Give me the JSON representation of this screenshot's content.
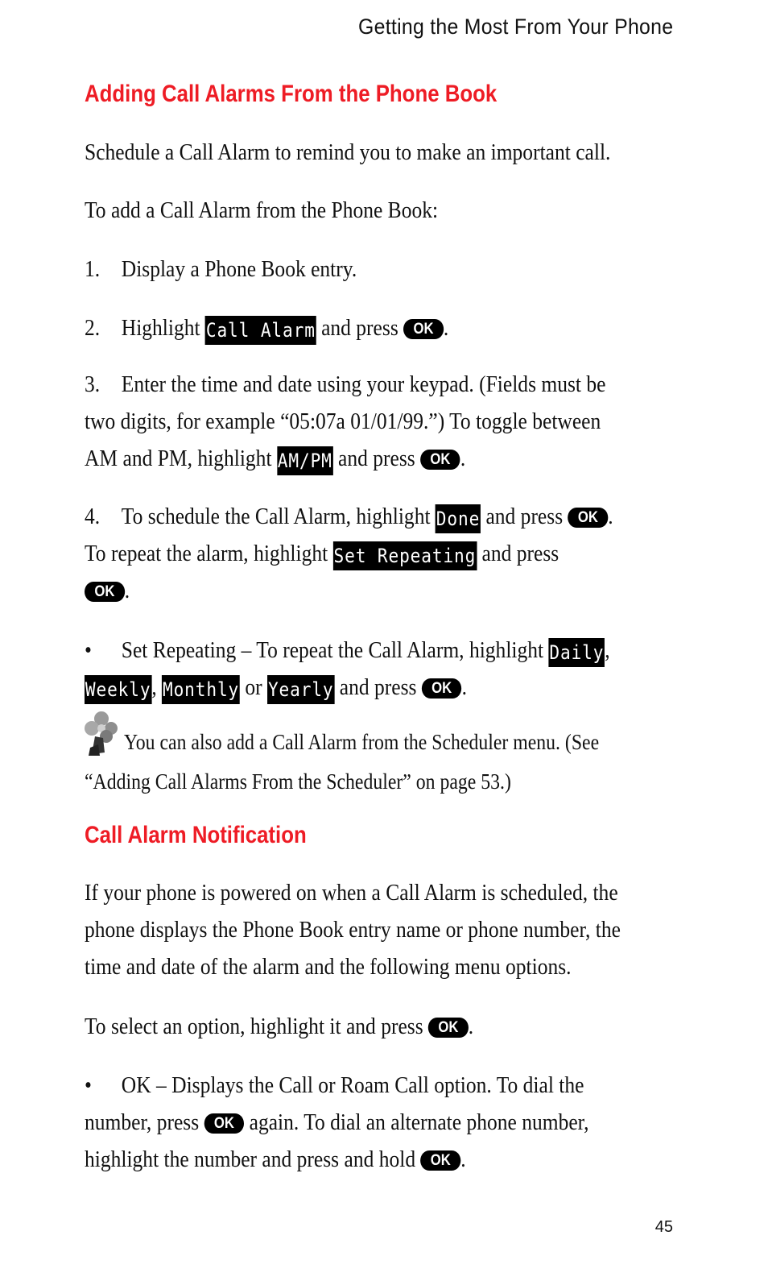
{
  "header": {
    "running_title": "Getting the Most From Your Phone"
  },
  "section1": {
    "heading": "Adding Call Alarms From the Phone Book",
    "intro": "Schedule a Call Alarm to remind you to make an important call.",
    "lead": "To add a Call Alarm from the Phone Book:",
    "steps": [
      {
        "num": "1.",
        "text": "Display a Phone Book entry."
      },
      {
        "num": "2.",
        "pre": "Highlight",
        "lcd": "Call Alarm",
        "post": "and press",
        "key": "OK"
      },
      {
        "num": "3.",
        "line1": "Enter the time and date using your keypad. (Fields must be",
        "line2": "two digits, for example “05:07a  01/01/99.”) To toggle between",
        "line3_pre": "AM and PM, highlight",
        "lcd": "AM/PM",
        "line3_post": "and press",
        "key": "OK"
      },
      {
        "num": "4.",
        "line1_pre": "To schedule the Call Alarm, highlight",
        "lcd1": "Done",
        "line1_post": "and press",
        "key": "OK",
        "line2_pre": "To repeat the alarm, highlight",
        "lcd2": "Set Repeating",
        "line2_post": "and press"
      }
    ],
    "bullet": {
      "symbol": "•",
      "pre": "Set Repeating – To repeat the Call Alarm, highlight",
      "options": [
        "Daily",
        "Weekly",
        "Monthly",
        "Yearly"
      ],
      "or": "or",
      "post": "and press",
      "key": "OK"
    },
    "note": {
      "icon": "note-flower-icon",
      "line1": "You can also add a Call Alarm from the Scheduler menu. (See",
      "line2": "“Adding Call Alarms From the Scheduler” on page 53.)"
    }
  },
  "section2": {
    "heading": "Call Alarm Notification",
    "para_lines": [
      "If your phone is powered on when a Call Alarm is scheduled, the",
      "phone displays the Phone Book entry name or phone number, the",
      "time and date of the alarm and the following menu options."
    ],
    "select_pre": "To select an option, highlight it and press",
    "key": "OK",
    "bullet": {
      "symbol": "•",
      "line1": "OK – Displays the Call or Roam Call option. To dial the",
      "line2_pre": "number, press",
      "line2_post": "again. To dial an alternate phone number,",
      "line3_pre": "highlight the number and press and hold"
    }
  },
  "footer": {
    "page_number": "45"
  }
}
